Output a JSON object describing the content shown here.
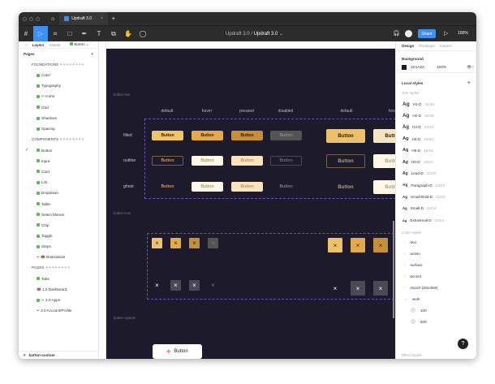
{
  "titlebar": {
    "tab_title": "Updraft 3.0",
    "new_tab": "+",
    "close": "×"
  },
  "toolbar": {
    "project": "Updraft 3.0",
    "separator": "/",
    "file": "Updraft 3.0",
    "share": "Share",
    "zoom": "100%"
  },
  "left": {
    "tabs": [
      "Layers",
      "Assets"
    ],
    "current_page": "Button",
    "pages_label": "Pages",
    "add": "+",
    "pages": [
      {
        "label": "FOUNDATIONS ✧✧✧✧✧✧✧✧",
        "type": "section"
      },
      {
        "label": "Color",
        "icon": "check"
      },
      {
        "label": "Typography",
        "icon": "check"
      },
      {
        "label": "✂ Icons",
        "icon": "check"
      },
      {
        "label": "Grid",
        "icon": "check"
      },
      {
        "label": "Shadows",
        "icon": "check"
      },
      {
        "label": "Spacing",
        "icon": "check"
      },
      {
        "label": "COMPONENTS ✧✧✧✧✧✧✧✧",
        "type": "section"
      },
      {
        "label": "Button",
        "icon": "check",
        "current": true
      },
      {
        "label": "Input",
        "icon": "check"
      },
      {
        "label": "Card",
        "icon": "check"
      },
      {
        "label": "List",
        "icon": "check"
      },
      {
        "label": "Dropdown",
        "icon": "check"
      },
      {
        "label": "Table",
        "icon": "check"
      },
      {
        "label": "Select Menus",
        "icon": "check"
      },
      {
        "label": "Chip",
        "icon": "check"
      },
      {
        "label": "Toggle",
        "icon": "check"
      },
      {
        "label": "Steps",
        "icon": "check"
      },
      {
        "label": "✂ 🍩 Illustrations",
        "icon": "none"
      },
      {
        "label": "PAGES ✧✧✧✧✧✧✧✧",
        "type": "section"
      },
      {
        "label": "Tabs",
        "icon": "check"
      },
      {
        "label": "🍩 1.0 Dashboard",
        "icon": "none"
      },
      {
        "label": "✂ 2.0 Apps",
        "icon": "check"
      },
      {
        "label": "✂ 3.0 Account/Profile",
        "icon": "none"
      }
    ],
    "bottom_layer": "button-custom"
  },
  "canvas": {
    "frame_labels": [
      "button-text",
      "button-icon",
      "button-custom"
    ],
    "columns": [
      "default",
      "hover",
      "pressed",
      "disabled",
      "default",
      "hover"
    ],
    "rows": [
      "filled",
      "outline",
      "ghost"
    ],
    "button_label": "Button",
    "icon_glyph": "×",
    "custom_button": "Button"
  },
  "right": {
    "tabs": [
      "Design",
      "Prototype",
      "Inspect"
    ],
    "background_label": "Background",
    "bg_hex": "1D1A2C",
    "bg_opacity": "100%",
    "local_styles": "Local styles",
    "text_styles_label": "Text styles",
    "text_styles": [
      {
        "name": "H1-D",
        "size": "32/48"
      },
      {
        "name": "H2-D",
        "size": "32/48"
      },
      {
        "name": "H3-D",
        "size": "24/40"
      },
      {
        "name": "H4-D",
        "size": "24/40"
      },
      {
        "name": "H5-D",
        "size": "16/24"
      },
      {
        "name": "H6-D",
        "size": "16/24"
      },
      {
        "name": "Lead-D",
        "size": "14/20"
      },
      {
        "name": "Paragraph-D",
        "size": "14/20"
      },
      {
        "name": "Small-Bold-D",
        "size": "12/16"
      },
      {
        "name": "Small-D",
        "size": "12/16"
      },
      {
        "name": "Extrasmall-D",
        "size": "10/14"
      }
    ],
    "color_styles_label": "Color styles",
    "color_groups": [
      "text",
      "action",
      "surface",
      "accent",
      "import [obsolete]",
      "work"
    ],
    "work_colors": [
      "100",
      "500"
    ],
    "effect_styles_label": "Effect styles",
    "help": "?"
  },
  "colors": {
    "accent": "#3d8ff3",
    "canvas": "#1d1a2c",
    "gold": "#e8b24f"
  }
}
